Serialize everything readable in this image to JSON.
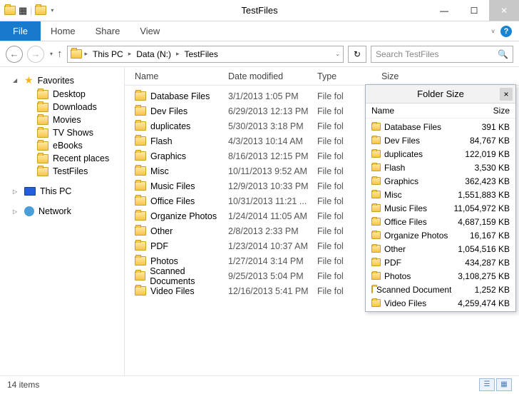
{
  "window": {
    "title": "TestFiles"
  },
  "ribbon": {
    "file": "File",
    "tabs": [
      "Home",
      "Share",
      "View"
    ]
  },
  "breadcrumb": {
    "parts": [
      "This PC",
      "Data (N:)",
      "TestFiles"
    ]
  },
  "search": {
    "placeholder": "Search TestFiles"
  },
  "sidebar": {
    "favorites_label": "Favorites",
    "favorites": [
      "Desktop",
      "Downloads",
      "Movies",
      "TV Shows",
      "eBooks",
      "Recent places",
      "TestFiles"
    ],
    "thispc_label": "This PC",
    "network_label": "Network"
  },
  "columns": {
    "name": "Name",
    "date": "Date modified",
    "type": "Type",
    "size": "Size"
  },
  "files": [
    {
      "name": "Database Files",
      "date": "3/1/2013 1:05 PM",
      "type": "File fol"
    },
    {
      "name": "Dev Files",
      "date": "6/29/2013 12:13 PM",
      "type": "File fol"
    },
    {
      "name": "duplicates",
      "date": "5/30/2013 3:18 PM",
      "type": "File fol"
    },
    {
      "name": "Flash",
      "date": "4/3/2013 10:14 AM",
      "type": "File fol"
    },
    {
      "name": "Graphics",
      "date": "8/16/2013 12:15 PM",
      "type": "File fol"
    },
    {
      "name": "Misc",
      "date": "10/11/2013 9:52 AM",
      "type": "File fol"
    },
    {
      "name": "Music Files",
      "date": "12/9/2013 10:33 PM",
      "type": "File fol"
    },
    {
      "name": "Office Files",
      "date": "10/31/2013 11:21 ...",
      "type": "File fol"
    },
    {
      "name": "Organize Photos",
      "date": "1/24/2014 11:05 AM",
      "type": "File fol"
    },
    {
      "name": "Other",
      "date": "2/8/2013 2:33 PM",
      "type": "File fol"
    },
    {
      "name": "PDF",
      "date": "1/23/2014 10:37 AM",
      "type": "File fol"
    },
    {
      "name": "Photos",
      "date": "1/27/2014 3:14 PM",
      "type": "File fol"
    },
    {
      "name": "Scanned Documents",
      "date": "9/25/2013 5:04 PM",
      "type": "File fol"
    },
    {
      "name": "Video Files",
      "date": "12/16/2013 5:41 PM",
      "type": "File fol"
    }
  ],
  "status": {
    "count": "14 items"
  },
  "popup": {
    "title": "Folder Size",
    "col_name": "Name",
    "col_size": "Size",
    "rows": [
      {
        "name": "Database Files",
        "size": "391 KB"
      },
      {
        "name": "Dev Files",
        "size": "84,767 KB"
      },
      {
        "name": "duplicates",
        "size": "122,019 KB"
      },
      {
        "name": "Flash",
        "size": "3,530 KB"
      },
      {
        "name": "Graphics",
        "size": "362,423 KB"
      },
      {
        "name": "Misc",
        "size": "1,551,883 KB"
      },
      {
        "name": "Music Files",
        "size": "11,054,972 KB"
      },
      {
        "name": "Office Files",
        "size": "4,687,159 KB"
      },
      {
        "name": "Organize Photos",
        "size": "16,167 KB"
      },
      {
        "name": "Other",
        "size": "1,054,516 KB"
      },
      {
        "name": "PDF",
        "size": "434,287 KB"
      },
      {
        "name": "Photos",
        "size": "3,108,275 KB"
      },
      {
        "name": "Scanned Documents",
        "size": "1,252 KB"
      },
      {
        "name": "Video Files",
        "size": "4,259,474 KB"
      }
    ]
  }
}
